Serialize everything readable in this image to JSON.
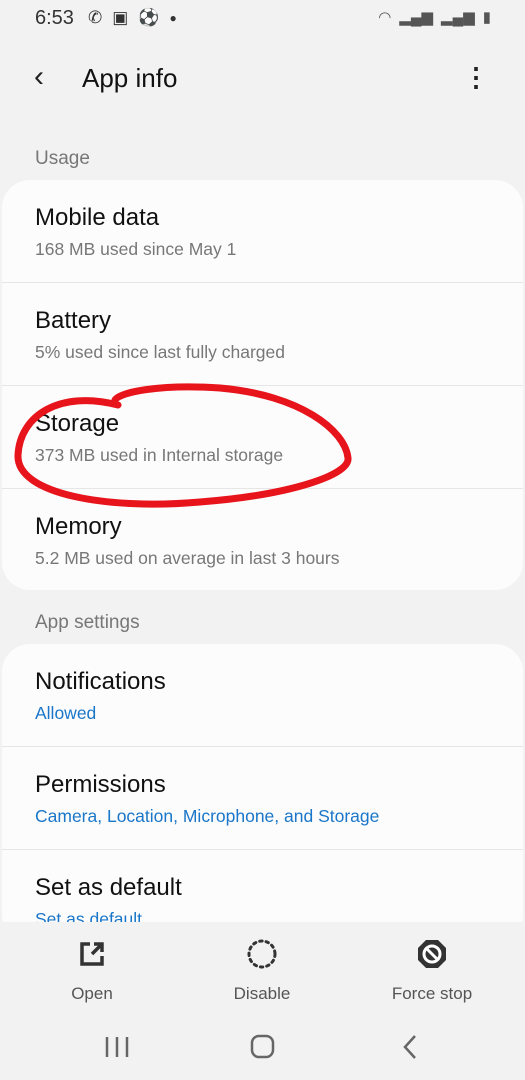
{
  "status_bar": {
    "time": "6:53",
    "left_icons": [
      "whatsapp-icon",
      "gallery-icon",
      "soccer-ball-icon",
      "dot-icon"
    ],
    "right_icons": [
      "wifi-icon",
      "signal-icon",
      "signal-icon",
      "battery-icon"
    ]
  },
  "header": {
    "title": "App info"
  },
  "usage": {
    "label": "Usage",
    "items": [
      {
        "title": "Mobile data",
        "subtitle": "168 MB used since May 1"
      },
      {
        "title": "Battery",
        "subtitle": "5% used since last fully charged"
      },
      {
        "title": "Storage",
        "subtitle": "373 MB used in Internal storage"
      },
      {
        "title": "Memory",
        "subtitle": "5.2 MB used on average in last 3 hours"
      }
    ]
  },
  "app_settings": {
    "label": "App settings",
    "items": [
      {
        "title": "Notifications",
        "subtitle": "Allowed"
      },
      {
        "title": "Permissions",
        "subtitle": "Camera, Location, Microphone, and Storage"
      },
      {
        "title": "Set as default",
        "subtitle": "Set as default"
      }
    ]
  },
  "actions": {
    "open": "Open",
    "disable": "Disable",
    "force_stop": "Force stop"
  },
  "colors": {
    "accent": "#1a76c9",
    "annotation": "#e8141c",
    "background": "#f2f2f2"
  }
}
